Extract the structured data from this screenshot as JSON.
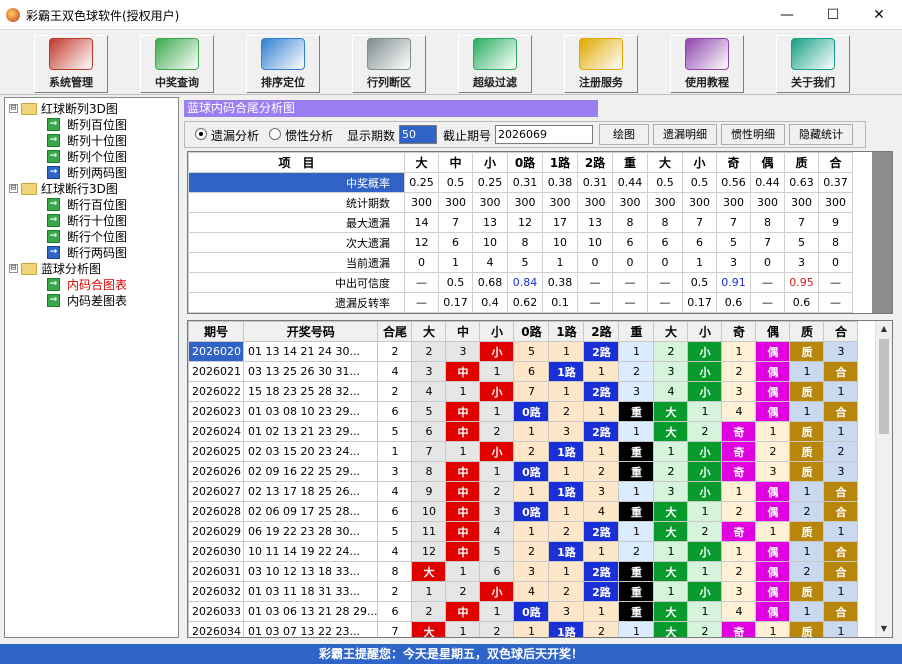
{
  "window": {
    "title": "彩霸王双色球软件(授权用户)",
    "controls": {
      "minimize": "—",
      "maximize": "☐",
      "close": "✕"
    }
  },
  "toolbar": [
    {
      "label": "系统管理",
      "icon": "toolbox-icon",
      "color": "#c0392b"
    },
    {
      "label": "中奖查询",
      "icon": "search-ticket-icon",
      "color": "#3aa84a"
    },
    {
      "label": "排序定位",
      "icon": "compass-icon",
      "color": "#2f80d1"
    },
    {
      "label": "行列断区",
      "icon": "grid-pencil-icon",
      "color": "#7f8c8d"
    },
    {
      "label": "超级过滤",
      "icon": "filter-cube-icon",
      "color": "#27ae60"
    },
    {
      "label": "注册服务",
      "icon": "key-icon",
      "color": "#e0a800"
    },
    {
      "label": "使用教程",
      "icon": "user-tutorial-icon",
      "color": "#8e44ad"
    },
    {
      "label": "关于我们",
      "icon": "phone-icon",
      "color": "#16a085"
    }
  ],
  "tree": {
    "groups": [
      {
        "label": "红球断列3D图",
        "expander": "⊟",
        "items": [
          "断列百位图",
          "断列十位图",
          "断列个位图",
          "断列两码图"
        ]
      },
      {
        "label": "红球断行3D图",
        "expander": "⊟",
        "items": [
          "断行百位图",
          "断行十位图",
          "断行个位图",
          "断行两码图"
        ]
      },
      {
        "label": "蓝球分析图",
        "expander": "⊟",
        "items": [
          "内码合图表",
          "内码差图表"
        ]
      }
    ],
    "selected": "内码合图表"
  },
  "panel": {
    "title": "蓝球内码合尾分析图"
  },
  "controls": {
    "radio_omission": "遗漏分析",
    "radio_inertia": "惯性分析",
    "display_label": "显示期数",
    "display_value": "50",
    "cutoff_label": "截止期号",
    "cutoff_value": "2026069",
    "buttons": [
      "绘图",
      "遗漏明细",
      "惯性明细",
      "隐藏统计"
    ]
  },
  "stats": {
    "headers": [
      "项　目",
      "大",
      "中",
      "小",
      "0路",
      "1路",
      "2路",
      "重",
      "大",
      "小",
      "奇",
      "偶",
      "质",
      "合"
    ],
    "rows": [
      {
        "label": "中奖概率",
        "cells": [
          "0.25",
          "0.5",
          "0.25",
          "0.31",
          "0.38",
          "0.31",
          "0.44",
          "0.5",
          "0.5",
          "0.56",
          "0.44",
          "0.63",
          "0.37"
        ]
      },
      {
        "label": "统计期数",
        "cells": [
          "300",
          "300",
          "300",
          "300",
          "300",
          "300",
          "300",
          "300",
          "300",
          "300",
          "300",
          "300",
          "300"
        ]
      },
      {
        "label": "最大遗漏",
        "cells": [
          "14",
          "7",
          "13",
          "12",
          "17",
          "13",
          "8",
          "8",
          "7",
          "7",
          "8",
          "7",
          "9"
        ]
      },
      {
        "label": "次大遗漏",
        "cells": [
          "12",
          "6",
          "10",
          "8",
          "10",
          "10",
          "6",
          "6",
          "6",
          "5",
          "7",
          "5",
          "8"
        ]
      },
      {
        "label": "当前遗漏",
        "cells": [
          "0",
          "1",
          "4",
          "5",
          "1",
          "0",
          "0",
          "0",
          "1",
          "3",
          "0",
          "3",
          "0"
        ]
      },
      {
        "label": "中出可信度",
        "cells": [
          "—",
          "0.5",
          "0.68",
          "0.84",
          "0.38",
          "—",
          "—",
          "—",
          "0.5",
          "0.91",
          "—",
          "0.95",
          "—"
        ]
      },
      {
        "label": "遗漏反转率",
        "cells": [
          "—",
          "0.17",
          "0.4",
          "0.62",
          "0.1",
          "—",
          "—",
          "—",
          "0.17",
          "0.6",
          "—",
          "0.6",
          "—"
        ]
      }
    ],
    "highlight_colors": {
      "0.84": "#1b2fd6",
      "0.91": "#1b2fd6",
      "0.95": "#d61b1b"
    }
  },
  "history": {
    "headers": [
      "期号",
      "开奖号码",
      "合尾",
      "大",
      "中",
      "小",
      "0路",
      "1路",
      "2路",
      "重",
      "大",
      "小",
      "奇",
      "偶",
      "质",
      "合"
    ],
    "rows": [
      {
        "period": "2026020",
        "nums": "01 13 14 21 24 30...",
        "tail": "2",
        "c": [
          "2",
          "3",
          "小",
          "5",
          "1",
          "2路",
          "1",
          "2",
          "小",
          "1",
          "偶",
          "质",
          "3"
        ]
      },
      {
        "period": "2026021",
        "nums": "03 13 25 26 30 31...",
        "tail": "4",
        "c": [
          "3",
          "中",
          "1",
          "6",
          "1路",
          "1",
          "2",
          "3",
          "小",
          "2",
          "偶",
          "1",
          "合"
        ]
      },
      {
        "period": "2026022",
        "nums": "15 18 23 25 28 32...",
        "tail": "2",
        "c": [
          "4",
          "1",
          "小",
          "7",
          "1",
          "2路",
          "3",
          "4",
          "小",
          "3",
          "偶",
          "质",
          "1"
        ]
      },
      {
        "period": "2026023",
        "nums": "01 03 08 10 23 29...",
        "tail": "6",
        "c": [
          "5",
          "中",
          "1",
          "0路",
          "2",
          "1",
          "重",
          "大",
          "1",
          "4",
          "偶",
          "1",
          "合"
        ]
      },
      {
        "period": "2026024",
        "nums": "01 02 13 21 23 29...",
        "tail": "5",
        "c": [
          "6",
          "中",
          "2",
          "1",
          "3",
          "2路",
          "1",
          "大",
          "2",
          "奇",
          "1",
          "质",
          "1"
        ]
      },
      {
        "period": "2026025",
        "nums": "02 03 15 20 23 24...",
        "tail": "1",
        "c": [
          "7",
          "1",
          "小",
          "2",
          "1路",
          "1",
          "重",
          "1",
          "小",
          "奇",
          "2",
          "质",
          "2"
        ]
      },
      {
        "period": "2026026",
        "nums": "02 09 16 22 25 29...",
        "tail": "3",
        "c": [
          "8",
          "中",
          "1",
          "0路",
          "1",
          "2",
          "重",
          "2",
          "小",
          "奇",
          "3",
          "质",
          "3"
        ]
      },
      {
        "period": "2026027",
        "nums": "02 13 17 18 25 26...",
        "tail": "4",
        "c": [
          "9",
          "中",
          "2",
          "1",
          "1路",
          "3",
          "1",
          "3",
          "小",
          "1",
          "偶",
          "1",
          "合"
        ]
      },
      {
        "period": "2026028",
        "nums": "02 06 09 17 25 28...",
        "tail": "6",
        "c": [
          "10",
          "中",
          "3",
          "0路",
          "1",
          "4",
          "重",
          "大",
          "1",
          "2",
          "偶",
          "2",
          "合"
        ]
      },
      {
        "period": "2026029",
        "nums": "06 19 22 23 28 30...",
        "tail": "5",
        "c": [
          "11",
          "中",
          "4",
          "1",
          "2",
          "2路",
          "1",
          "大",
          "2",
          "奇",
          "1",
          "质",
          "1"
        ]
      },
      {
        "period": "2026030",
        "nums": "10 11 14 19 22 24...",
        "tail": "4",
        "c": [
          "12",
          "中",
          "5",
          "2",
          "1路",
          "1",
          "2",
          "1",
          "小",
          "1",
          "偶",
          "1",
          "合"
        ]
      },
      {
        "period": "2026031",
        "nums": "03 10 12 13 18 33...",
        "tail": "8",
        "c": [
          "大",
          "1",
          "6",
          "3",
          "1",
          "2路",
          "重",
          "大",
          "1",
          "2",
          "偶",
          "2",
          "合"
        ]
      },
      {
        "period": "2026032",
        "nums": "01 03 11 18 31 33...",
        "tail": "2",
        "c": [
          "1",
          "2",
          "小",
          "4",
          "2",
          "2路",
          "重",
          "1",
          "小",
          "3",
          "偶",
          "质",
          "1"
        ]
      },
      {
        "period": "2026033",
        "nums": "01 03 06 13 21 28 29...",
        "tail": "6",
        "c": [
          "2",
          "中",
          "1",
          "0路",
          "3",
          "1",
          "重",
          "大",
          "1",
          "4",
          "偶",
          "1",
          "合"
        ]
      },
      {
        "period": "2026034",
        "nums": "01 03 07 13 22 23...",
        "tail": "7",
        "c": [
          "大",
          "1",
          "2",
          "1",
          "1路",
          "2",
          "1",
          "大",
          "2",
          "奇",
          "1",
          "质",
          "1"
        ]
      }
    ],
    "cell_colors": {
      "大": {
        "bg": "#e00000",
        "fg": "#ffffff"
      },
      "中": {
        "bg": "#e00000",
        "fg": "#ffffff"
      },
      "小": {
        "bg": "#e00000",
        "fg": "#ffffff"
      },
      "0路": {
        "bg": "#1b2fd6",
        "fg": "#ffffff"
      },
      "1路": {
        "bg": "#1b2fd6",
        "fg": "#ffffff"
      },
      "2路": {
        "bg": "#1b2fd6",
        "fg": "#ffffff"
      },
      "重": {
        "bg": "#000000",
        "fg": "#ffffff"
      },
      "大2": {
        "bg": "#089a2c",
        "fg": "#ffffff"
      },
      "小2": {
        "bg": "#089a2c",
        "fg": "#ffffff"
      },
      "奇": {
        "bg": "#e000e0",
        "fg": "#ffffff"
      },
      "偶": {
        "bg": "#e000e0",
        "fg": "#ffffff"
      },
      "质": {
        "bg": "#b8860b",
        "fg": "#ffffff"
      },
      "合": {
        "bg": "#b8860b",
        "fg": "#ffffff"
      }
    }
  },
  "statusbar": {
    "text": "彩霸王提醒您：今天是星期五，双色球后天开奖！"
  }
}
